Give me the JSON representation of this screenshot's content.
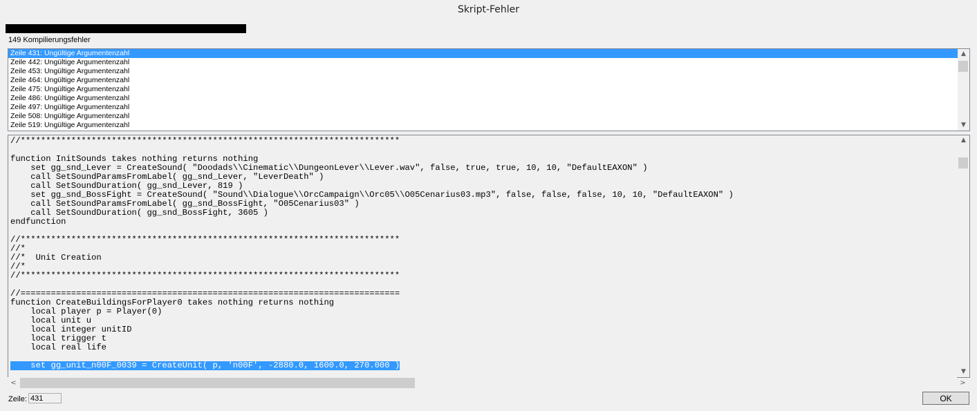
{
  "window": {
    "title": "Skript-Fehler"
  },
  "errors": {
    "count_label": "149 Kompilierungsfehler",
    "items": [
      "Zeile 431: Ungültige Argumentenzahl",
      "Zeile 442: Ungültige Argumentenzahl",
      "Zeile 453: Ungültige Argumentenzahl",
      "Zeile 464: Ungültige Argumentenzahl",
      "Zeile 475: Ungültige Argumentenzahl",
      "Zeile 486: Ungültige Argumentenzahl",
      "Zeile 497: Ungültige Argumentenzahl",
      "Zeile 508: Ungültige Argumentenzahl",
      "Zeile 519: Ungültige Argumentenzahl"
    ],
    "selected_index": 0
  },
  "code": {
    "lines": [
      "//***************************************************************************",
      "",
      "function InitSounds takes nothing returns nothing",
      "    set gg_snd_Lever = CreateSound( \"Doodads\\\\Cinematic\\\\DungeonLever\\\\Lever.wav\", false, true, true, 10, 10, \"DefaultEAXON\" )",
      "    call SetSoundParamsFromLabel( gg_snd_Lever, \"LeverDeath\" )",
      "    call SetSoundDuration( gg_snd_Lever, 819 )",
      "    set gg_snd_BossFight = CreateSound( \"Sound\\\\Dialogue\\\\OrcCampaign\\\\Orc05\\\\O05Cenarius03.mp3\", false, false, false, 10, 10, \"DefaultEAXON\" )",
      "    call SetSoundParamsFromLabel( gg_snd_BossFight, \"O05Cenarius03\" )",
      "    call SetSoundDuration( gg_snd_BossFight, 3605 )",
      "endfunction",
      "",
      "//***************************************************************************",
      "//*",
      "//*  Unit Creation",
      "//*",
      "//***************************************************************************",
      "",
      "//===========================================================================",
      "function CreateBuildingsForPlayer0 takes nothing returns nothing",
      "    local player p = Player(0)",
      "    local unit u",
      "    local integer unitID",
      "    local trigger t",
      "    local real life",
      "",
      "    set gg_unit_n00F_0039 = CreateUnit( p, 'n00F', -2880.0, 1600.0, 270.000 )"
    ],
    "highlighted_index": 25
  },
  "status": {
    "line_label": "Zeile:",
    "line_value": "431"
  },
  "buttons": {
    "ok_label": "OK"
  },
  "icons": {
    "up": "▲",
    "down": "▼",
    "left": "<",
    "right": ">"
  }
}
